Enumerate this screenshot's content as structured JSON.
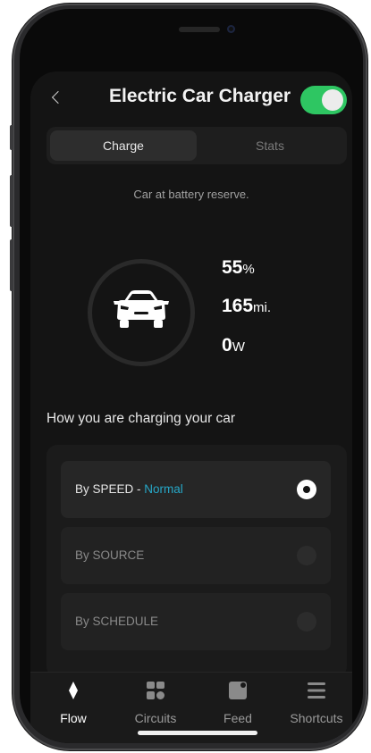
{
  "header": {
    "title": "Electric Car Charger",
    "toggle_on": true,
    "back_icon": "chevron-left-icon"
  },
  "tabs": [
    {
      "label": "Charge",
      "active": true
    },
    {
      "label": "Stats",
      "active": false
    }
  ],
  "status": {
    "text": "Car at battery reserve."
  },
  "car_stats": {
    "icon": "car-front-icon",
    "battery": {
      "value": "55",
      "unit": "%"
    },
    "range": {
      "value": "165",
      "unit": "mi."
    },
    "power": {
      "value": "0",
      "unit": "W"
    }
  },
  "charging_section": {
    "title": "How you are charging your car",
    "options": [
      {
        "label": "By SPEED - ",
        "accent": "Normal",
        "selected": true
      },
      {
        "label": "By SOURCE",
        "selected": false
      },
      {
        "label": "By SCHEDULE",
        "selected": false
      }
    ]
  },
  "nav": {
    "items": [
      {
        "label": "Flow",
        "icon": "flow-icon",
        "active": true
      },
      {
        "label": "Circuits",
        "icon": "circuits-icon",
        "active": false
      },
      {
        "label": "Feed",
        "icon": "feed-icon",
        "active": false
      },
      {
        "label": "Shortcuts",
        "icon": "shortcuts-icon",
        "active": false
      }
    ]
  },
  "colors": {
    "toggle_on": "#2ec662",
    "accent": "#26a8c8",
    "background": "#141414"
  }
}
